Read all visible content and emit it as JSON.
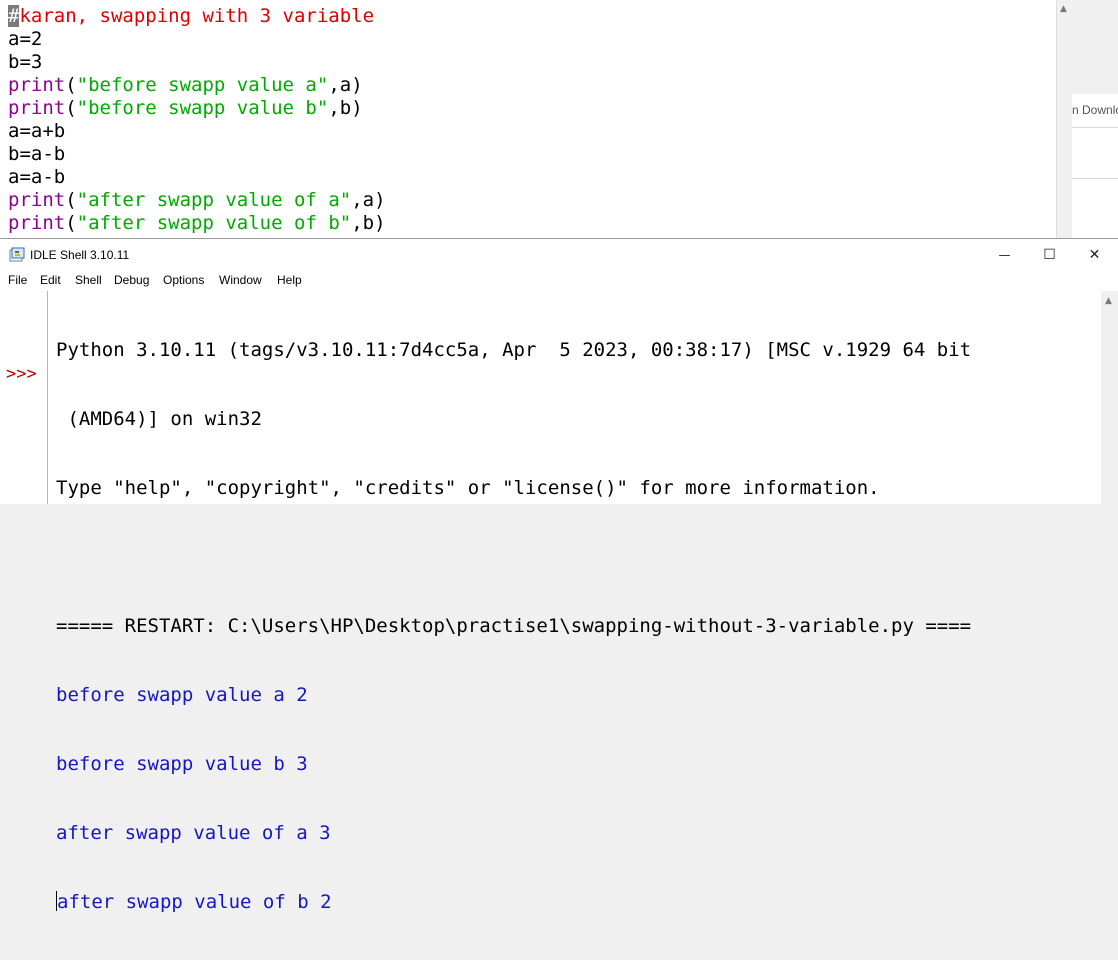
{
  "editor": {
    "lines": [
      [
        {
          "t": "#",
          "c": "caret-block"
        },
        {
          "t": "karan, swapping with 3 variable",
          "c": "c-comment"
        }
      ],
      [
        {
          "t": "a=2",
          "c": "c-plain"
        }
      ],
      [
        {
          "t": "b=3",
          "c": "c-plain"
        }
      ],
      [
        {
          "t": "print",
          "c": "c-kw"
        },
        {
          "t": "(",
          "c": "c-plain"
        },
        {
          "t": "\"before swapp value a\"",
          "c": "c-str"
        },
        {
          "t": ",a)",
          "c": "c-plain"
        }
      ],
      [
        {
          "t": "print",
          "c": "c-kw"
        },
        {
          "t": "(",
          "c": "c-plain"
        },
        {
          "t": "\"before swapp value b\"",
          "c": "c-str"
        },
        {
          "t": ",b)",
          "c": "c-plain"
        }
      ],
      [
        {
          "t": "a=a+b",
          "c": "c-plain"
        }
      ],
      [
        {
          "t": "b=a-b",
          "c": "c-plain"
        }
      ],
      [
        {
          "t": "a=a-b",
          "c": "c-plain"
        }
      ],
      [
        {
          "t": "print",
          "c": "c-kw"
        },
        {
          "t": "(",
          "c": "c-plain"
        },
        {
          "t": "\"after swapp value of a\"",
          "c": "c-str"
        },
        {
          "t": ",a)",
          "c": "c-plain"
        }
      ],
      [
        {
          "t": "print",
          "c": "c-kw"
        },
        {
          "t": "(",
          "c": "c-plain"
        },
        {
          "t": "\"after swapp value of b\"",
          "c": "c-str"
        },
        {
          "t": ",b)",
          "c": "c-plain"
        }
      ]
    ]
  },
  "background_window": {
    "partial_text": "n Downlo"
  },
  "shell": {
    "title": "IDLE Shell 3.10.11",
    "menu": [
      "File",
      "Edit",
      "Shell",
      "Debug",
      "Options",
      "Window",
      "Help"
    ],
    "prompt": ">>>",
    "banner_line1": "Python 3.10.11 (tags/v3.10.11:7d4cc5a, Apr  5 2023, 00:38:17) [MSC v.1929 64 bit",
    "banner_line2": " (AMD64)] on win32",
    "banner_line3": "Type \"help\", \"copyright\", \"credits\" or \"license()\" for more information.",
    "restart_line": "===== RESTART: C:\\Users\\HP\\Desktop\\practise1\\swapping-without-3-variable.py ====",
    "output": [
      "before swapp value a 2",
      "before swapp value b 3",
      "after swapp value of a 3",
      "after swapp value of b 2"
    ],
    "window_buttons": {
      "minimize": "—",
      "maximize": "☐",
      "close": "✕"
    }
  }
}
